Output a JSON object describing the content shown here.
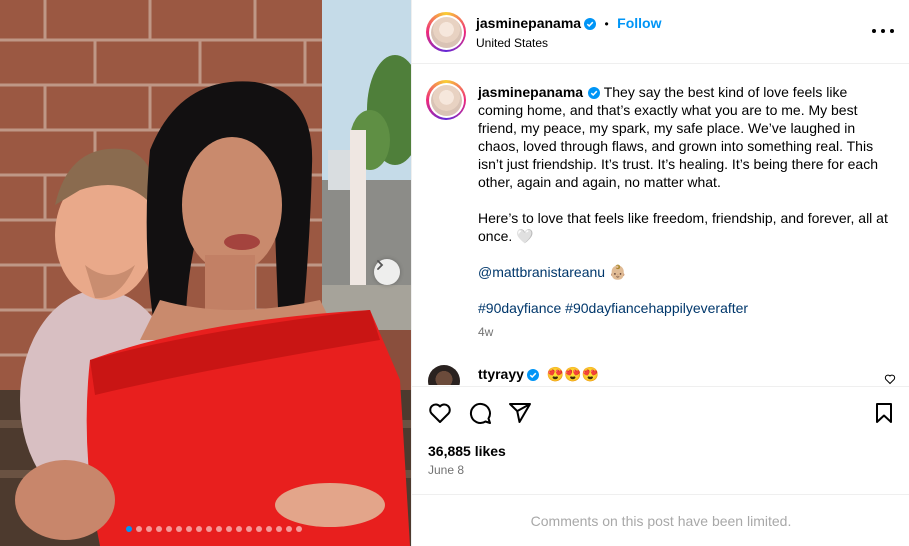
{
  "post": {
    "author": "jasminepanama",
    "follow_label": "Follow",
    "separator": "•",
    "location": "United States"
  },
  "caption": {
    "author": "jasminepanama",
    "paragraph1": "They say the best kind of love feels like coming home, and that’s exactly what you are to me. My best friend, my peace, my spark, my safe place. We’ve laughed in chaos, loved through flaws, and grown into something real. This isn’t just friendship. It’s trust. It’s healing. It’s being there for each other, again and again, no matter what.",
    "paragraph2": "Here’s to love that feels like freedom, friendship, and forever, all at once. 🤍",
    "mention": "@mattbranistareanu",
    "mention_emoji": "👶🏼",
    "hashtags": "#90dayfiance #90dayfiancehappilyeverafter",
    "time_ago": "4w"
  },
  "comment": {
    "user": "ttyrayy",
    "text": "😍😍😍"
  },
  "stats": {
    "likes": "36,885 likes",
    "date": "June 8"
  },
  "footer": {
    "limited_text": "Comments on this post have been limited."
  },
  "carousel": {
    "total_slides": 18,
    "active_slide": 1
  },
  "icons": {
    "verified": "verified-badge-icon",
    "like": "heart-icon",
    "comment": "comment-bubble-icon",
    "share": "paper-plane-icon",
    "save": "bookmark-icon",
    "more": "more-options-icon",
    "next": "chevron-right-icon"
  },
  "colors": {
    "accent": "#0095f6",
    "link": "#00376b",
    "muted": "#737373",
    "verified": "#0095f6"
  }
}
